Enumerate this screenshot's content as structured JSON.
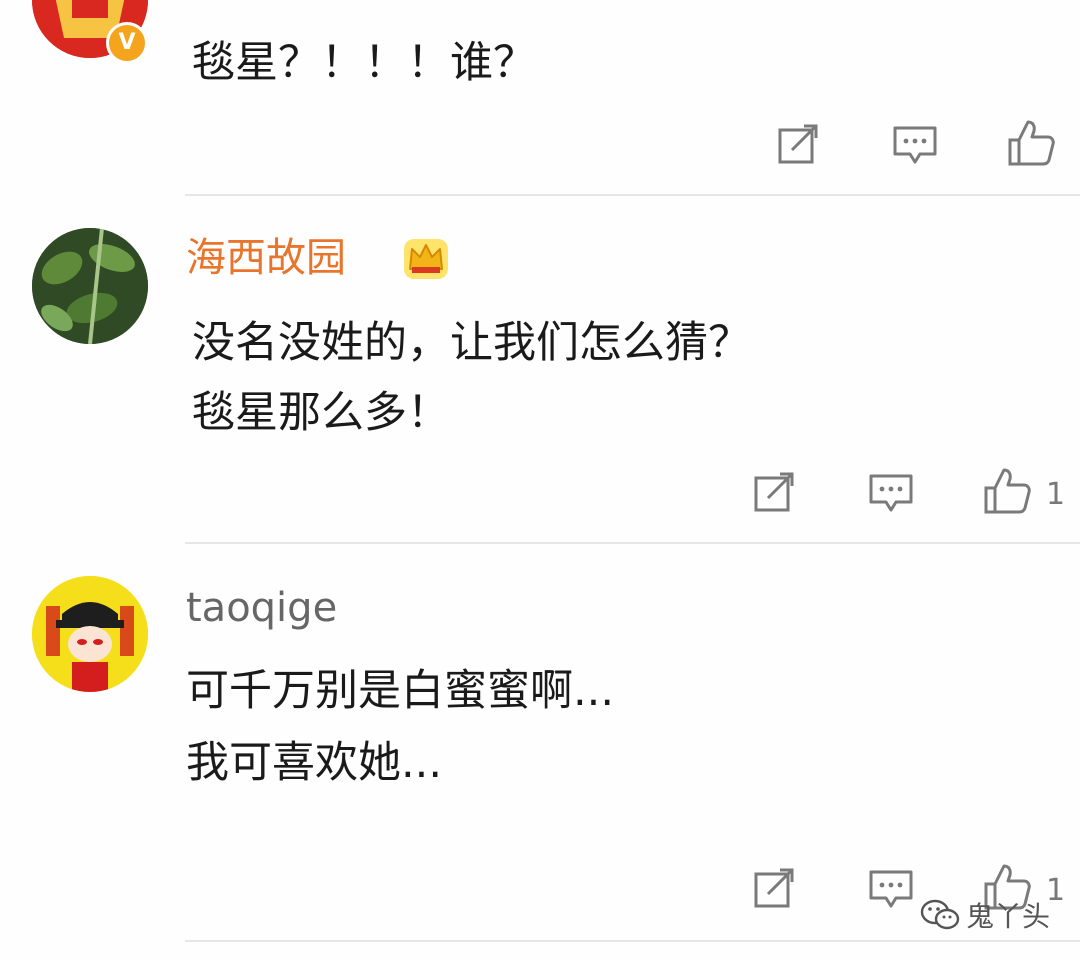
{
  "comments": [
    {
      "username": "",
      "verified_badge": "V",
      "text_lines": [
        "毯星？！！！谁？"
      ],
      "actions": {
        "like_count": ""
      }
    },
    {
      "username": "海西故园",
      "username_color": "#e8752b",
      "badge_icon": "crown-icon",
      "text_lines": [
        "没名没姓的，让我们怎么猜？",
        "毯星那么多！"
      ],
      "actions": {
        "like_count": "1"
      }
    },
    {
      "username": "taoqige",
      "username_color": "#666666",
      "text_lines": [
        "可千万别是白蜜蜜啊...",
        "我可喜欢她..."
      ],
      "actions": {
        "like_count": "1"
      }
    }
  ],
  "icons": {
    "repost": "repost-icon",
    "comment": "comment-icon",
    "like": "thumbs-up-icon"
  },
  "watermark": {
    "icon": "wechat-icon",
    "text": "鬼丫头"
  },
  "colors": {
    "accent": "#e8752b",
    "icon_gray": "#7a7a7a",
    "divider": "#e6e6e6"
  }
}
